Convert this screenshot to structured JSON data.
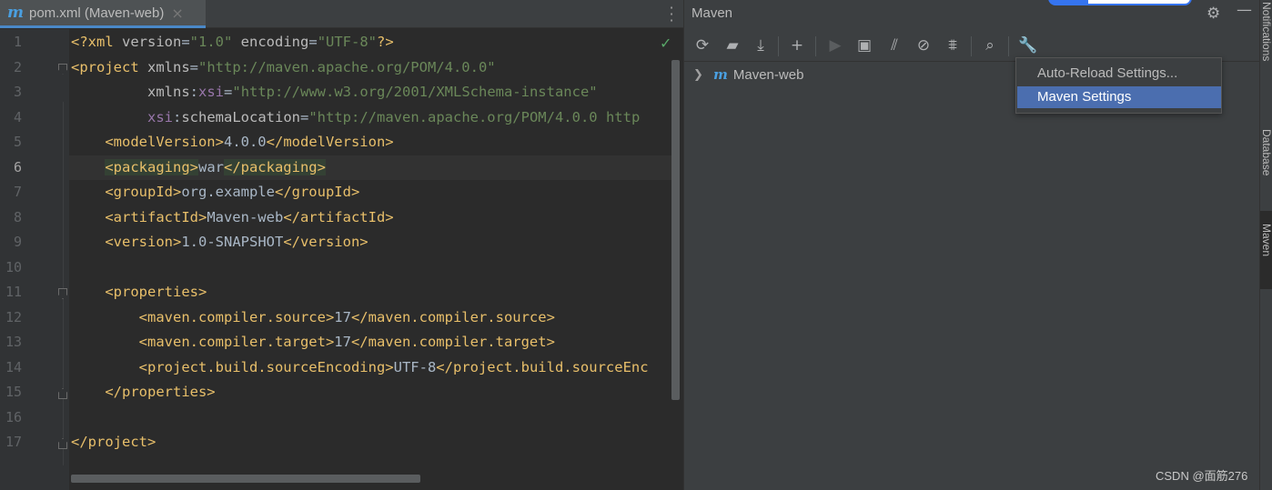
{
  "editor": {
    "tab": {
      "icon": "maven-m-icon",
      "label": "pom.xml (Maven-web)",
      "close": "×"
    },
    "line_numbers": [
      "1",
      "2",
      "3",
      "4",
      "5",
      "6",
      "7",
      "8",
      "9",
      "10",
      "11",
      "12",
      "13",
      "14",
      "15",
      "16",
      "17"
    ],
    "current_line": 6,
    "lines": [
      [
        {
          "c": "tg",
          "t": "<?xml "
        },
        {
          "c": "an",
          "t": "version"
        },
        {
          "c": "tx",
          "t": "="
        },
        {
          "c": "av",
          "t": "\"1.0\""
        },
        {
          "c": "an",
          "t": " encoding"
        },
        {
          "c": "tx",
          "t": "="
        },
        {
          "c": "av",
          "t": "\"UTF-8\""
        },
        {
          "c": "tg",
          "t": "?>"
        }
      ],
      [
        {
          "c": "tg",
          "t": "<project "
        },
        {
          "c": "an",
          "t": "xmlns"
        },
        {
          "c": "tx",
          "t": "="
        },
        {
          "c": "av",
          "t": "\"http://maven.apache.org/POM/4.0.0\""
        }
      ],
      [
        {
          "c": "tx",
          "t": "         "
        },
        {
          "c": "an",
          "t": "xmlns"
        },
        {
          "c": "tx",
          "t": ":"
        },
        {
          "c": "ns",
          "t": "xsi"
        },
        {
          "c": "tx",
          "t": "="
        },
        {
          "c": "av",
          "t": "\"http://www.w3.org/2001/XMLSchema-instance\""
        }
      ],
      [
        {
          "c": "tx",
          "t": "         "
        },
        {
          "c": "ns",
          "t": "xsi"
        },
        {
          "c": "tx",
          "t": ":"
        },
        {
          "c": "an",
          "t": "schemaLocation"
        },
        {
          "c": "tx",
          "t": "="
        },
        {
          "c": "av",
          "t": "\"http://maven.apache.org/POM/4.0.0 http"
        }
      ],
      [
        {
          "c": "tx",
          "t": "    "
        },
        {
          "c": "tg",
          "t": "<modelVersion>"
        },
        {
          "c": "tx",
          "t": "4.0.0"
        },
        {
          "c": "tg",
          "t": "</modelVersion>"
        }
      ],
      [
        {
          "c": "tx",
          "t": "    "
        },
        {
          "c": "tg hl",
          "t": "<packaging>"
        },
        {
          "c": "tx",
          "t": "war"
        },
        {
          "c": "tg hl",
          "t": "</packaging>"
        }
      ],
      [
        {
          "c": "tx",
          "t": "    "
        },
        {
          "c": "tg",
          "t": "<groupId>"
        },
        {
          "c": "tx",
          "t": "org.example"
        },
        {
          "c": "tg",
          "t": "</groupId>"
        }
      ],
      [
        {
          "c": "tx",
          "t": "    "
        },
        {
          "c": "tg",
          "t": "<artifactId>"
        },
        {
          "c": "tx",
          "t": "Maven-web"
        },
        {
          "c": "tg",
          "t": "</artifactId>"
        }
      ],
      [
        {
          "c": "tx",
          "t": "    "
        },
        {
          "c": "tg",
          "t": "<version>"
        },
        {
          "c": "tx",
          "t": "1.0-SNAPSHOT"
        },
        {
          "c": "tg",
          "t": "</version>"
        }
      ],
      [],
      [
        {
          "c": "tx",
          "t": "    "
        },
        {
          "c": "tg",
          "t": "<properties>"
        }
      ],
      [
        {
          "c": "tx",
          "t": "        "
        },
        {
          "c": "tg",
          "t": "<maven.compiler.source>"
        },
        {
          "c": "tx",
          "t": "17"
        },
        {
          "c": "tg",
          "t": "</maven.compiler.source>"
        }
      ],
      [
        {
          "c": "tx",
          "t": "        "
        },
        {
          "c": "tg",
          "t": "<maven.compiler.target>"
        },
        {
          "c": "tx",
          "t": "17"
        },
        {
          "c": "tg",
          "t": "</maven.compiler.target>"
        }
      ],
      [
        {
          "c": "tx",
          "t": "        "
        },
        {
          "c": "tg",
          "t": "<project.build.sourceEncoding>"
        },
        {
          "c": "tx",
          "t": "UTF-8"
        },
        {
          "c": "tg",
          "t": "</project.build.sourceEnc"
        }
      ],
      [
        {
          "c": "tx",
          "t": "    "
        },
        {
          "c": "tg",
          "t": "</properties>"
        }
      ],
      [],
      [
        {
          "c": "tg",
          "t": "</project>"
        }
      ]
    ],
    "inspection_status": "check-icon"
  },
  "maven": {
    "title": "Maven",
    "header_icons": [
      "gear-icon",
      "minimize-icon"
    ],
    "toolbar": [
      {
        "name": "reload-all-projects-icon",
        "glyph": "⟳",
        "enabled": true
      },
      {
        "name": "generate-sources-icon",
        "glyph": "▰",
        "enabled": true
      },
      {
        "name": "download-sources-icon",
        "glyph": "⤓",
        "enabled": true
      },
      {
        "name": "add-maven-project-icon",
        "glyph": "+",
        "enabled": true
      },
      {
        "name": "run-maven-build-icon",
        "glyph": "▶",
        "enabled": false
      },
      {
        "name": "execute-maven-goal-icon",
        "glyph": "▣",
        "enabled": true
      },
      {
        "name": "toggle-offline-mode-icon",
        "glyph": "⫽",
        "enabled": true
      },
      {
        "name": "skip-tests-icon",
        "glyph": "⊘",
        "enabled": true
      },
      {
        "name": "collapse-all-icon",
        "glyph": "⩨",
        "enabled": true
      },
      {
        "name": "analyze-dependencies-icon",
        "glyph": "⌕",
        "enabled": true
      },
      {
        "name": "build-tool-settings-icon",
        "glyph": "🔧",
        "enabled": true
      }
    ],
    "tree": [
      {
        "label": "Maven-web",
        "icon": "maven-project-icon",
        "expanded": false
      }
    ],
    "settings_menu": {
      "items": [
        {
          "label": "Auto-Reload Settings...",
          "selected": false
        },
        {
          "label": "Maven Settings",
          "selected": true
        }
      ]
    }
  },
  "right_stripe": {
    "items": [
      {
        "label": "Notifications",
        "active": false
      },
      {
        "label": "Database",
        "active": false
      },
      {
        "label": "Maven",
        "active": true
      }
    ]
  },
  "watermark": "CSDN @面筋276",
  "colors": {
    "editor_bg": "#2b2b2b",
    "panel_bg": "#3c3f41",
    "selection": "#4b6eaf",
    "accent": "#3574f0",
    "xml_tag": "#e8bf6a",
    "xml_value": "#6a8759"
  }
}
